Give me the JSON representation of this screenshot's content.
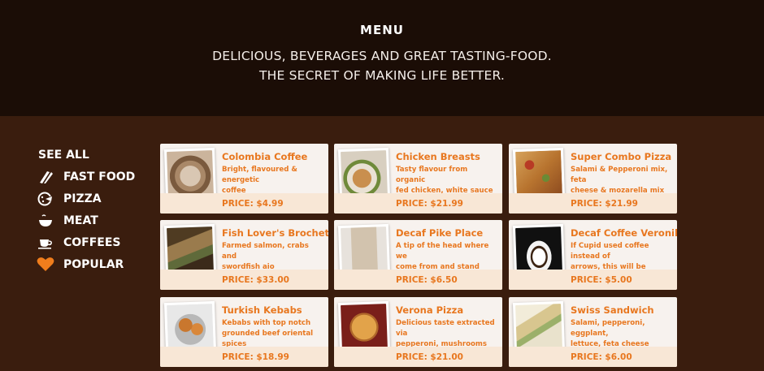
{
  "hero": {
    "title": "MENU",
    "line1": "DELICIOUS, BEVERAGES AND GREAT TASTING-FOOD.",
    "line2": "THE SECRET OF MAKING LIFE BETTER."
  },
  "sidebar": {
    "items": [
      {
        "label": "SEE ALL",
        "icon": "none"
      },
      {
        "label": "FAST FOOD",
        "icon": "utensils-icon"
      },
      {
        "label": "PIZZA",
        "icon": "pizza-icon"
      },
      {
        "label": "MEAT",
        "icon": "bowl-icon"
      },
      {
        "label": "COFFEES",
        "icon": "coffee-cup-icon"
      },
      {
        "label": "POPULAR",
        "icon": "heart-icon"
      }
    ],
    "accent_color": "#f07d1c"
  },
  "menu_items": [
    {
      "name": "Colombia Coffee",
      "desc_line1": "Bright, flavoured & energetic",
      "desc_line2": "coffee",
      "price": "PRICE: $4.99"
    },
    {
      "name": "Chicken Breasts",
      "desc_line1": "Tasty flavour from organic",
      "desc_line2": "fed chicken, white sauce",
      "price": "PRICE: $21.99"
    },
    {
      "name": "Super Combo Pizza",
      "desc_line1": "Salami & Pepperoni mix, feta",
      "desc_line2": "cheese & mozarella mix",
      "price": "PRICE: $21.99"
    },
    {
      "name": "Fish Lover's Brochette",
      "desc_line1": "Farmed salmon, crabs and",
      "desc_line2": "swordfish aio",
      "price": "PRICE: $33.00"
    },
    {
      "name": "Decaf Pike Place",
      "desc_line1": "A tip of the head where we",
      "desc_line2": "come from and stand",
      "price": "PRICE: $6.50"
    },
    {
      "name": "Decaf Coffee Veronika",
      "desc_line1": "If Cupid used coffee instead of",
      "desc_line2": "arrows, this will be served",
      "price": "PRICE: $5.00"
    },
    {
      "name": "Turkish Kebabs",
      "desc_line1": "Kebabs with top notch",
      "desc_line2": "grounded beef oriental spices",
      "price": "PRICE: $18.99"
    },
    {
      "name": "Verona Pizza",
      "desc_line1": "Delicious taste extracted via",
      "desc_line2": "pepperoni, mushrooms",
      "price": "PRICE: $21.00"
    },
    {
      "name": "Swiss Sandwich",
      "desc_line1": "Salami, pepperoni, eggplant,",
      "desc_line2": "lettuce, feta cheese",
      "price": "PRICE: $6.00"
    }
  ],
  "colors": {
    "hero_bg": "#1b0d06",
    "main_bg": "#3a1d0e",
    "card_bg": "#f7f2ee",
    "price_bar_bg": "#f8e7d6",
    "accent_text": "#e8771f"
  }
}
